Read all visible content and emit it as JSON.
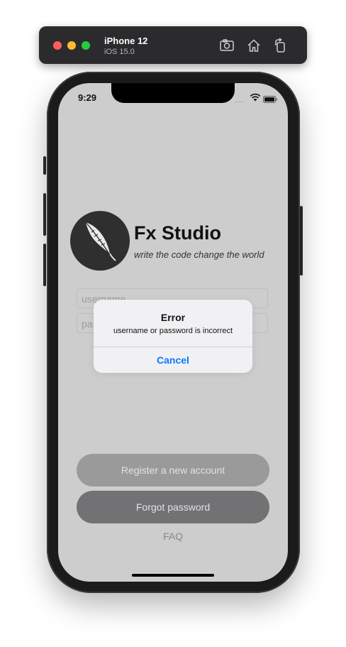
{
  "simulator": {
    "device_name": "iPhone 12",
    "os_version": "iOS 15.0",
    "icons": [
      "screenshot-icon",
      "home-icon",
      "rotate-icon"
    ]
  },
  "status_bar": {
    "time": "9:29",
    "signal_dots": "....",
    "icons": [
      "wifi-icon",
      "battery-icon"
    ]
  },
  "brand": {
    "name": "Fx Studio",
    "tagline": "write the code change the world",
    "logo_icon": "feather-icon"
  },
  "form": {
    "username_placeholder": "username",
    "password_placeholder": "password"
  },
  "buttons": {
    "register": "Register a new account",
    "forgot": "Forgot password",
    "faq": "FAQ"
  },
  "alert": {
    "title": "Error",
    "message": "username or password is incorrect",
    "cancel": "Cancel"
  },
  "colors": {
    "alert_action": "#0a7aff",
    "screen_dim": "#cdcdcd"
  }
}
